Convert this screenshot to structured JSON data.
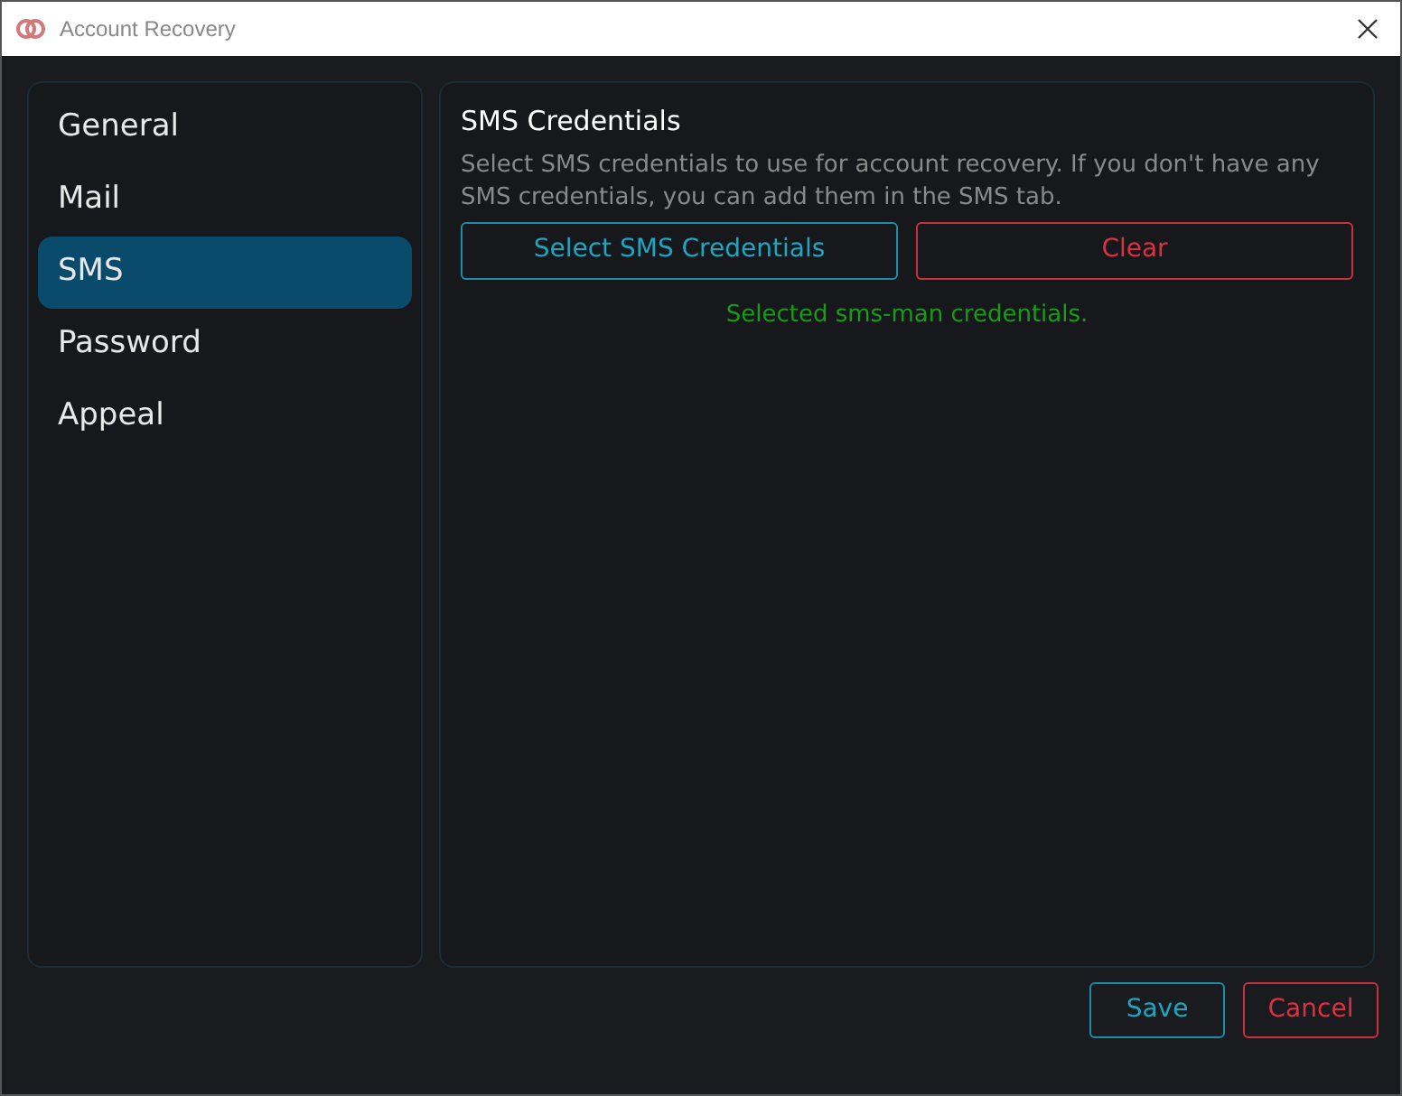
{
  "window": {
    "title": "Account Recovery"
  },
  "sidebar": {
    "items": [
      {
        "label": "General",
        "selected": false
      },
      {
        "label": "Mail",
        "selected": false
      },
      {
        "label": "SMS",
        "selected": true
      },
      {
        "label": "Password",
        "selected": false
      },
      {
        "label": "Appeal",
        "selected": false
      }
    ]
  },
  "panel": {
    "title": "SMS Credentials",
    "description": "Select SMS credentials to use for account recovery. If you don't have any SMS credentials, you can add them in the SMS tab.",
    "buttons": [
      {
        "label": "Select SMS Credentials",
        "kind": "primary"
      },
      {
        "label": "Clear",
        "kind": "danger"
      }
    ],
    "status": "Selected sms-man credentials."
  },
  "footer_buttons": [
    {
      "label": "Save",
      "kind": "primary"
    },
    {
      "label": "Cancel",
      "kind": "danger"
    }
  ]
}
